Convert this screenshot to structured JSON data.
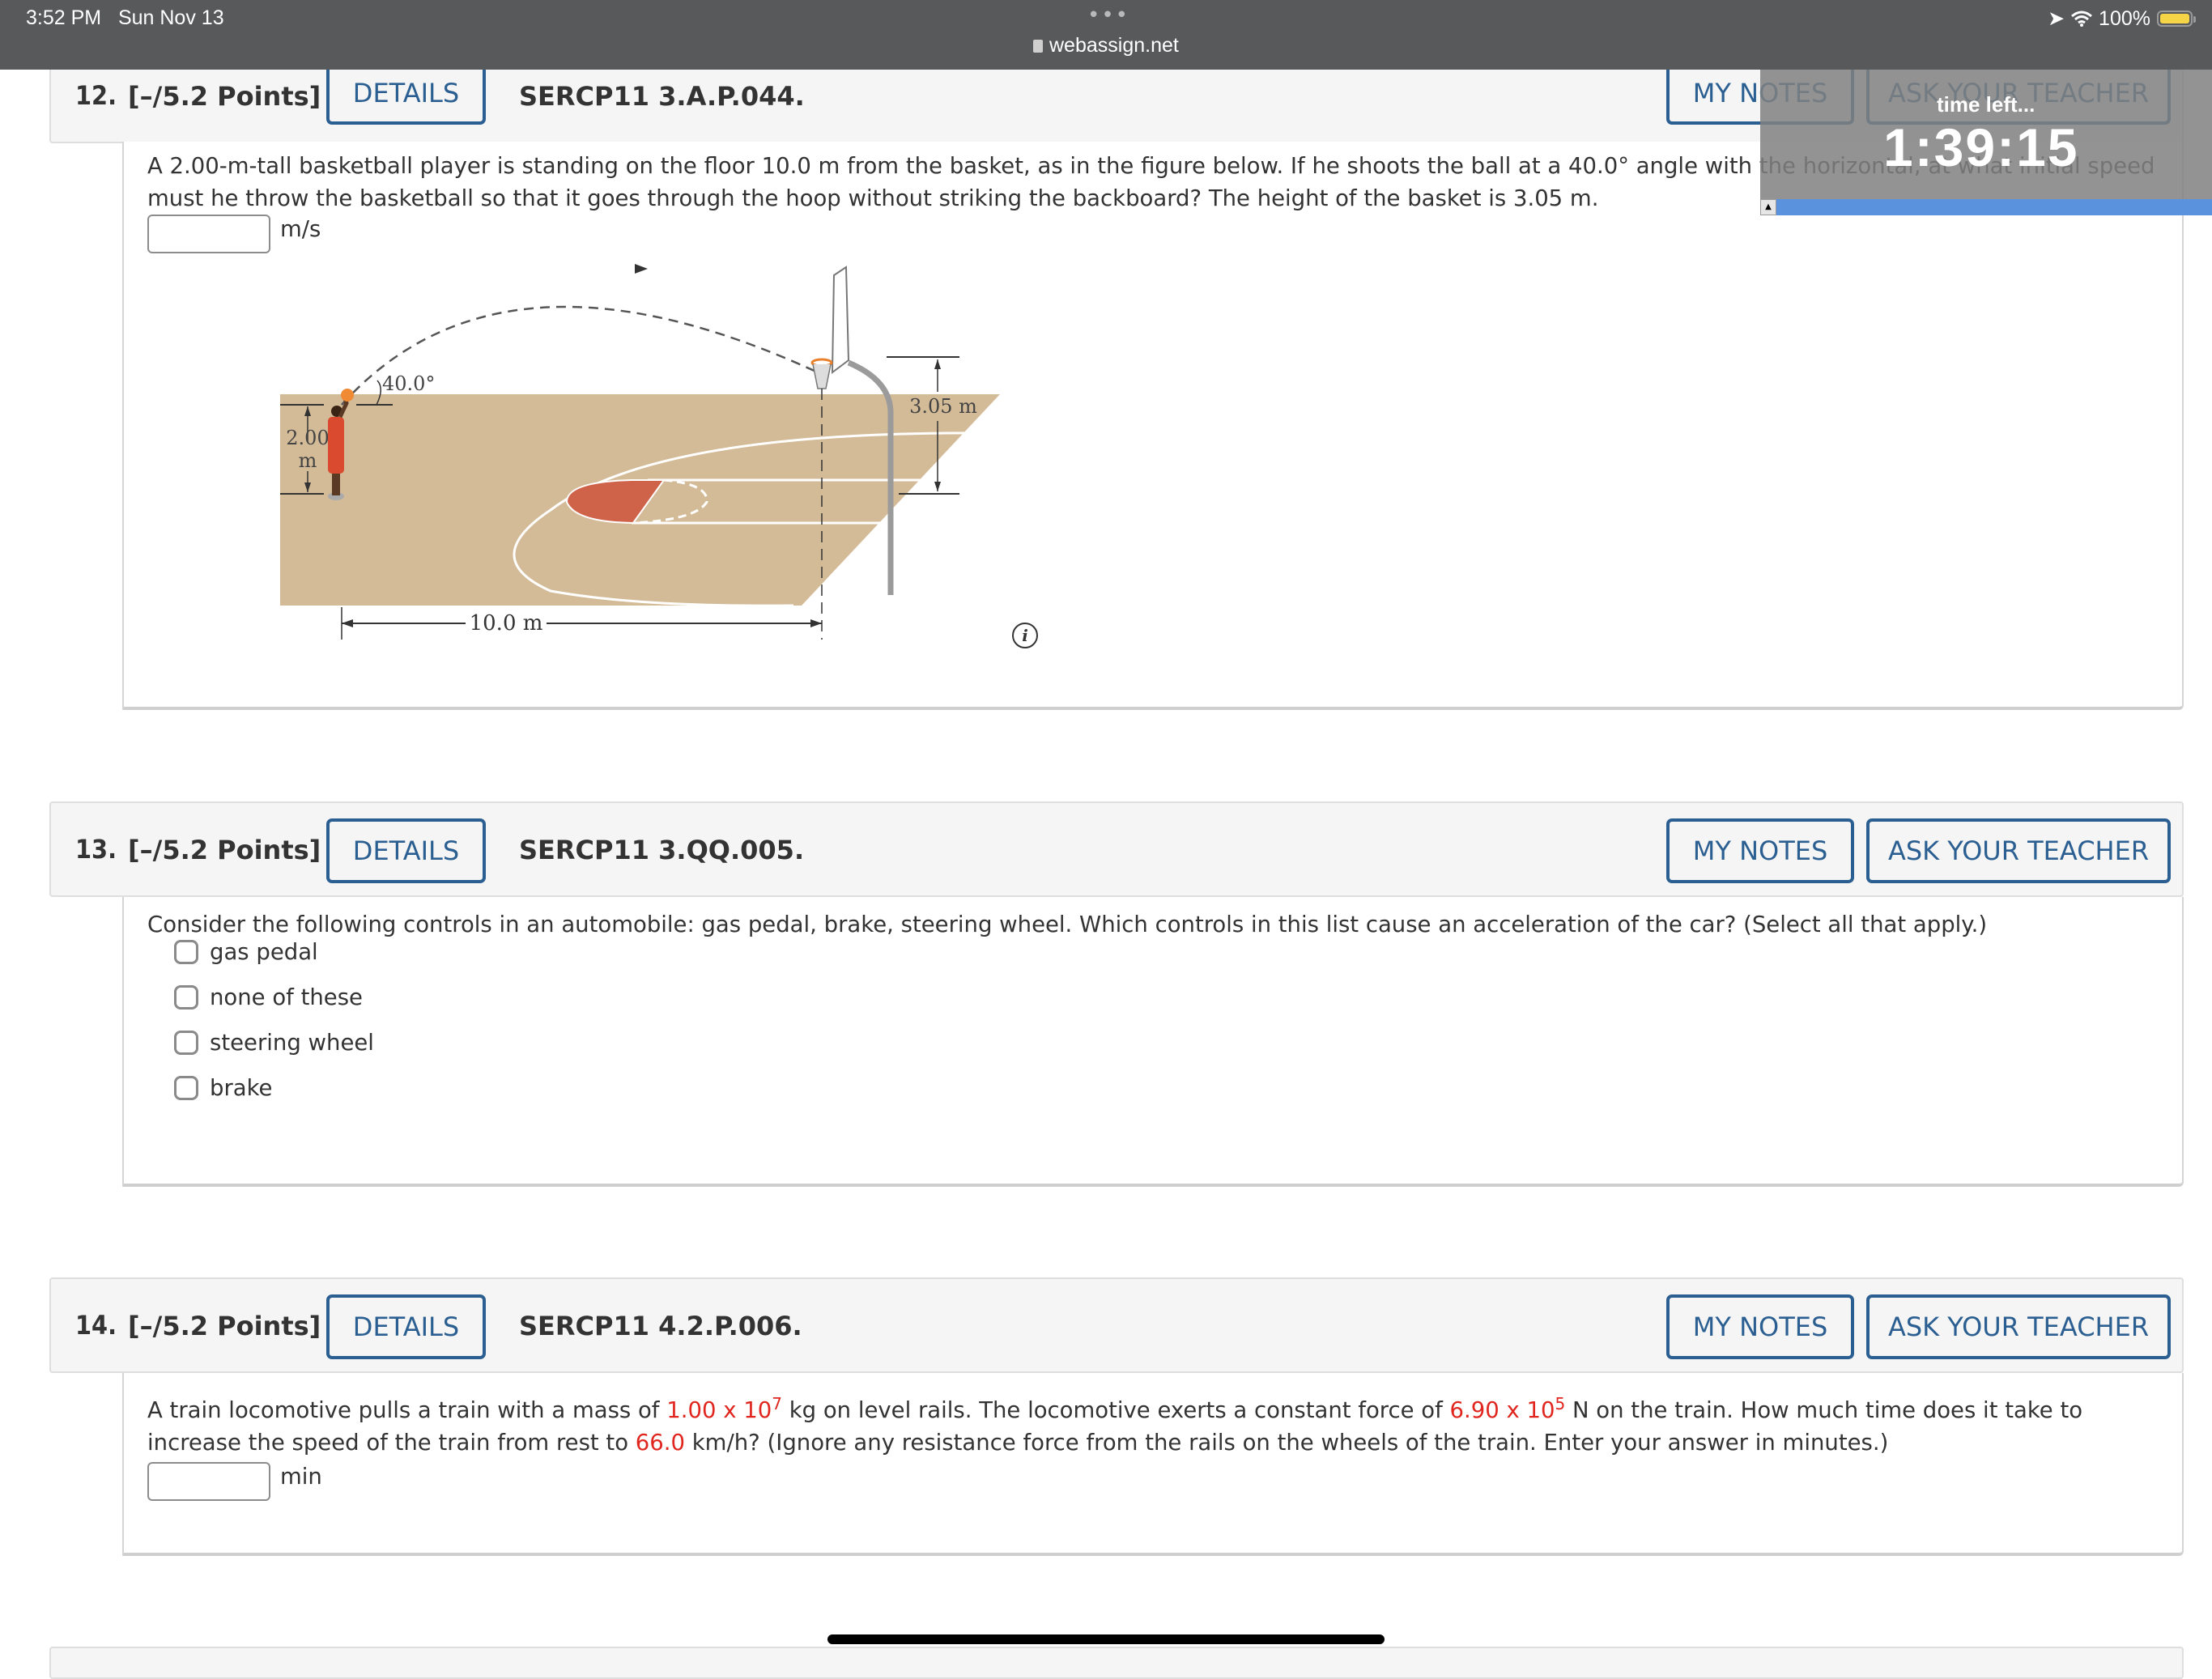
{
  "status_bar": {
    "time": "3:52 PM",
    "date": "Sun Nov 13",
    "url": "webassign.net",
    "battery": "100%"
  },
  "timer": {
    "label": "time left...",
    "value": "1:39:15"
  },
  "buttons": {
    "details": "DETAILS",
    "my_notes": "MY NOTES",
    "ask_teacher": "ASK YOUR TEACHER"
  },
  "questions": [
    {
      "number": "12.",
      "points": "[–/5.2 Points]",
      "code": "SERCP11 3.A.P.044.",
      "text": "A 2.00-m-tall basketball player is standing on the floor 10.0 m from the basket, as in the figure below. If he shoots the ball at a 40.0° angle with the horizontal, at what initial speed must he throw the basketball so that it goes through the hoop without striking the backboard? The height of the basket is 3.05 m.",
      "answer_value": "",
      "unit": "m/s",
      "figure": {
        "angle_label": "40.0°",
        "height_label_line1": "2.00",
        "height_label_line2": "m",
        "hoop_height_label": "3.05 m",
        "distance_label": "10.0 m"
      }
    },
    {
      "number": "13.",
      "points": "[–/5.2 Points]",
      "code": "SERCP11 3.QQ.005.",
      "text": "Consider the following controls in an automobile: gas pedal, brake, steering wheel. Which controls in this list cause an acceleration of the car? (Select all that apply.)",
      "options": [
        {
          "label": "gas pedal",
          "checked": false
        },
        {
          "label": "none of these",
          "checked": false
        },
        {
          "label": "steering wheel",
          "checked": false
        },
        {
          "label": "brake",
          "checked": false
        }
      ]
    },
    {
      "number": "14.",
      "points": "[–/5.2 Points]",
      "code": "SERCP11 4.2.P.006.",
      "text_parts": {
        "p1": "A train locomotive pulls a train with a mass of ",
        "mass_mantissa": "1.00 x 10",
        "mass_exp": "7",
        "p2": " kg on level rails. The locomotive exerts a constant force of ",
        "force_mantissa": "6.90 x 10",
        "force_exp": "5",
        "p3": " N on the train. How much time does it take to increase the speed of the train from rest to ",
        "speed": "66.0",
        "p4": " km/h? (Ignore any resistance force from the rails on the wheels of the train. Enter your answer in minutes.)"
      },
      "answer_value": "",
      "unit": "min"
    }
  ]
}
